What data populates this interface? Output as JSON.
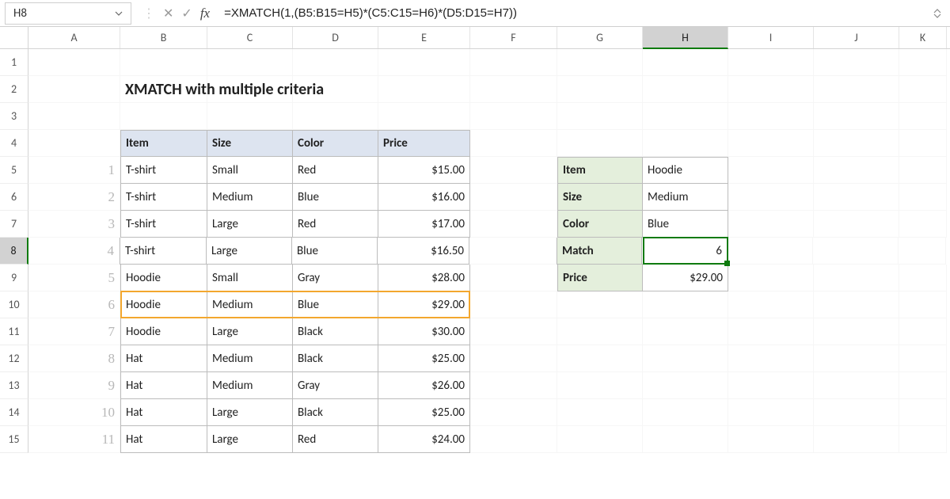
{
  "namebox": "H8",
  "formula": "=XMATCH(1,(B5:B15=H5)*(C5:C15=H6)*(D5:D15=H7))",
  "columns": [
    "A",
    "B",
    "C",
    "D",
    "E",
    "F",
    "G",
    "H",
    "I",
    "J",
    "K"
  ],
  "rows": [
    "1",
    "2",
    "3",
    "4",
    "5",
    "6",
    "7",
    "8",
    "9",
    "10",
    "11",
    "12",
    "13",
    "14",
    "15"
  ],
  "title": "XMATCH with multiple criteria",
  "headers": {
    "item": "Item",
    "size": "Size",
    "color": "Color",
    "price": "Price"
  },
  "index": [
    "1",
    "2",
    "3",
    "4",
    "5",
    "6",
    "7",
    "8",
    "9",
    "10",
    "11"
  ],
  "data": [
    {
      "item": "T-shirt",
      "size": "Small",
      "color": "Red",
      "price": "$15.00"
    },
    {
      "item": "T-shirt",
      "size": "Medium",
      "color": "Blue",
      "price": "$16.00"
    },
    {
      "item": "T-shirt",
      "size": "Large",
      "color": "Red",
      "price": "$17.00"
    },
    {
      "item": "T-shirt",
      "size": "Large",
      "color": "Blue",
      "price": "$16.50"
    },
    {
      "item": "Hoodie",
      "size": "Small",
      "color": "Gray",
      "price": "$28.00"
    },
    {
      "item": "Hoodie",
      "size": "Medium",
      "color": "Blue",
      "price": "$29.00"
    },
    {
      "item": "Hoodie",
      "size": "Large",
      "color": "Black",
      "price": "$30.00"
    },
    {
      "item": "Hat",
      "size": "Medium",
      "color": "Black",
      "price": "$25.00"
    },
    {
      "item": "Hat",
      "size": "Medium",
      "color": "Gray",
      "price": "$26.00"
    },
    {
      "item": "Hat",
      "size": "Large",
      "color": "Black",
      "price": "$25.00"
    },
    {
      "item": "Hat",
      "size": "Large",
      "color": "Red",
      "price": "$24.00"
    }
  ],
  "lookup": {
    "labels": {
      "item": "Item",
      "size": "Size",
      "color": "Color",
      "match": "Match",
      "price": "Price"
    },
    "values": {
      "item": "Hoodie",
      "size": "Medium",
      "color": "Blue",
      "match": "6",
      "price": "$29.00"
    }
  },
  "active_col": "H",
  "active_row": "8",
  "chart_data": {
    "type": "table",
    "title": "XMATCH with multiple criteria",
    "columns": [
      "Item",
      "Size",
      "Color",
      "Price"
    ],
    "rows": [
      [
        "T-shirt",
        "Small",
        "Red",
        15.0
      ],
      [
        "T-shirt",
        "Medium",
        "Blue",
        16.0
      ],
      [
        "T-shirt",
        "Large",
        "Red",
        17.0
      ],
      [
        "T-shirt",
        "Large",
        "Blue",
        16.5
      ],
      [
        "Hoodie",
        "Small",
        "Gray",
        28.0
      ],
      [
        "Hoodie",
        "Medium",
        "Blue",
        29.0
      ],
      [
        "Hoodie",
        "Large",
        "Black",
        30.0
      ],
      [
        "Hat",
        "Medium",
        "Black",
        25.0
      ],
      [
        "Hat",
        "Medium",
        "Gray",
        26.0
      ],
      [
        "Hat",
        "Large",
        "Black",
        25.0
      ],
      [
        "Hat",
        "Large",
        "Red",
        24.0
      ]
    ],
    "lookup": {
      "Item": "Hoodie",
      "Size": "Medium",
      "Color": "Blue",
      "Match": 6,
      "Price": 29.0
    }
  }
}
